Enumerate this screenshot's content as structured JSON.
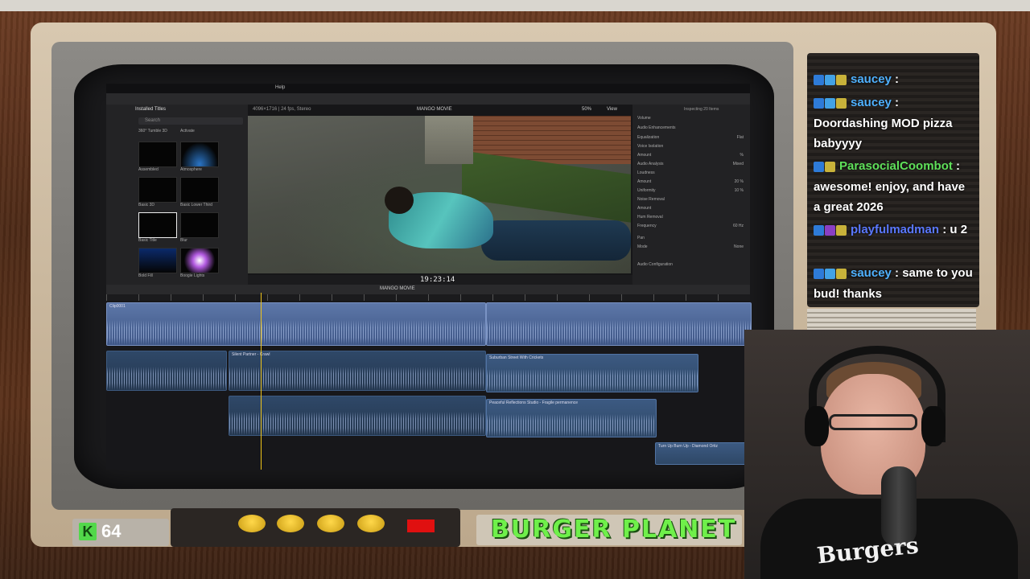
{
  "app": {
    "menubar_item": "Help",
    "browser": {
      "header": "Installed Titles",
      "search_placeholder": "Search",
      "top_items": [
        "360° Tumble 3D",
        "Activate"
      ],
      "tiles": [
        {
          "label": "Assembled"
        },
        {
          "label": "Atmosphere"
        },
        {
          "label": "Basic 3D"
        },
        {
          "label": "Basic Lower Third"
        },
        {
          "label": "Basic Title"
        },
        {
          "label": "Blur"
        },
        {
          "label": "Bold Fill"
        },
        {
          "label": "Boogie Lights"
        }
      ]
    },
    "viewer": {
      "info": "4096×1716 | 24 fps, Stereo",
      "title": "MANGO MOVIE",
      "zoom": "50%",
      "view_menu": "View",
      "timecode": "19:23:14"
    },
    "inspector": {
      "header": "Inspecting 20 Items",
      "rows": [
        {
          "label": "Volume",
          "value": ""
        },
        {
          "label": "Audio Enhancements",
          "value": ""
        },
        {
          "label": "Equalization",
          "value": "Flat"
        },
        {
          "label": "Voice Isolation",
          "value": ""
        },
        {
          "label": "Amount",
          "value": "%"
        },
        {
          "label": "Audio Analysis",
          "value": "Mixed"
        },
        {
          "label": "Loudness",
          "value": ""
        },
        {
          "label": "Amount",
          "value": "20 %"
        },
        {
          "label": "Uniformity",
          "value": "10 %"
        },
        {
          "label": "Noise Removal",
          "value": ""
        },
        {
          "label": "Amount",
          "value": ""
        },
        {
          "label": "Hum Removal",
          "value": ""
        },
        {
          "label": "Frequency",
          "value": "60 Hz"
        },
        {
          "label": "Pan",
          "value": ""
        },
        {
          "label": "Mode",
          "value": "None"
        },
        {
          "label": "Audio Configuration",
          "value": ""
        }
      ]
    },
    "timeline": {
      "project": "MANGO MOVIE",
      "clips": [
        {
          "label": "Clip0001"
        },
        {
          "label": "Silent Partner - Crawl"
        },
        {
          "label": "Suburban Street With Crickets"
        },
        {
          "label": "Peaceful Reflections Studio - Fragile permanence"
        },
        {
          "label": "Turn Up Burn Up - Diamond Ortiz"
        }
      ]
    }
  },
  "chat": {
    "messages": [
      {
        "user": "saucey",
        "text": "",
        "user_color": "blue"
      },
      {
        "user": "saucey",
        "text": "Doordashing MOD pizza babyyyy",
        "user_color": "blue"
      },
      {
        "user": "ParasocialCoombot",
        "text": "awesome! enjoy, and have a great 2026",
        "user_color": "green"
      },
      {
        "user": "playfulmadman",
        "text": "u 2",
        "user_color": "purple"
      },
      {
        "user": "saucey",
        "text": "same to you bud! thanks",
        "user_color": "blue"
      }
    ]
  },
  "overlay": {
    "k_badge": "K",
    "k_count": "64",
    "brand": "BURGER PLANET",
    "shirt_text": "Burgers"
  },
  "colors": {
    "accent_green": "#6ff04a",
    "chat_blue": "#4fb1ff",
    "chat_green": "#5fe05a",
    "chat_purple": "#5a78ff"
  }
}
